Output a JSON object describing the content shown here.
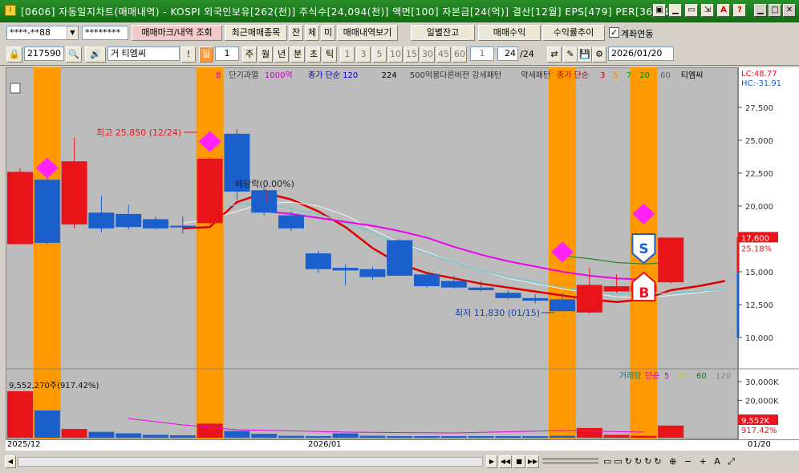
{
  "window": {
    "title": "[0606] 자동일지차트(매매내역) - KOSPI 외국인보유[262(천)] 주식수[24,094(천)] 액면[100] 자본금[24(억)] 결산[12월] EPS[479] PER[36.74]",
    "icon_label": "I",
    "title_icons": [
      "window-icon",
      "minimize-small-icon",
      "restore-small-icon",
      "link-icon",
      "print-icon",
      "help-icon"
    ],
    "title_icon_glyphs": [
      "▣",
      "▁",
      "▭",
      "⇲",
      "A",
      "?"
    ],
    "controls": [
      "▁",
      "□",
      "✕"
    ]
  },
  "toolbar1": {
    "account": "****-**88",
    "password": "********",
    "trade_mark_btn": "매매마크/내역 조회",
    "recent_trades_btn": "최근매매종목",
    "balance_btn": "잔",
    "fill_btn": "체",
    "unfilled_btn": "미",
    "trade_detail_btn": "매매내역보기",
    "daily_balance_btn": "일별잔고",
    "trade_profit_btn": "매매수익",
    "return_trend_btn": "수익률추이",
    "account_link_label": "계좌연동",
    "account_link_checked": true
  },
  "toolbar2": {
    "stock_code": "217590",
    "stock_name": "티엠씨",
    "stock_prefix": "거",
    "period_buttons": [
      "일",
      "주",
      "월",
      "년",
      "분",
      "초",
      "틱"
    ],
    "period_value": "1",
    "interval_buttons": [
      "1",
      "3",
      "5",
      "10",
      "15",
      "30",
      "45",
      "60"
    ],
    "interval_value": "1",
    "count": "24",
    "count_total": "/24",
    "date": "2026/01/20",
    "exclaim": "!"
  },
  "chart_legend": {
    "items": [
      {
        "text": "8",
        "color": "#cc00cc"
      },
      {
        "text": "단기과열",
        "color": "#333333"
      },
      {
        "text": "1000억",
        "color": "#cc00cc"
      },
      {
        "text": "종가 단순 120",
        "color": "#0000cc"
      },
      {
        "text": "224",
        "color": "#000000"
      },
      {
        "text": "500억봉다른버전 강세패턴",
        "color": "#333333"
      },
      {
        "text": "약세패턴",
        "color": "#333333"
      },
      {
        "text": "종가 단순",
        "color": "#cc0000"
      },
      {
        "text": "3",
        "color": "#cc0000"
      },
      {
        "text": "5",
        "color": "#ff8800"
      },
      {
        "text": "7",
        "color": "#00aa00"
      },
      {
        "text": "20",
        "color": "#008800"
      },
      {
        "text": "60",
        "color": "#666666"
      },
      {
        "text": "티엠씨",
        "color": "#000000"
      }
    ],
    "lc": "LC:48.77",
    "hc": "HC:-31.91"
  },
  "annotations": {
    "high": "최고 25,850 (12/24)",
    "low": "최저 11,830 (01/15)",
    "dividend": "배당락(0.00%)",
    "sell": "S",
    "buy": "B",
    "volume_max": "9,552,270주(917.42%)"
  },
  "price_axis": {
    "ticks": [
      "27,500",
      "25,000",
      "22,500",
      "20,000",
      "17,500",
      "15,000",
      "12,500",
      "10,000"
    ],
    "current_price": "17,600",
    "current_change": "25.18%"
  },
  "volume_legend": {
    "items": [
      {
        "text": "거래량",
        "color": "#008888"
      },
      {
        "text": "단순",
        "color": "#cc00cc"
      },
      {
        "text": "5",
        "color": "#cc00cc"
      },
      {
        "text": "20",
        "color": "#cccc00"
      },
      {
        "text": "60",
        "color": "#008800"
      },
      {
        "text": "120",
        "color": "#888888"
      }
    ],
    "ticks": [
      "30,000K",
      "20,000K",
      "10,000K"
    ],
    "current": "9,552K",
    "current_pct": "917.42%"
  },
  "x_axis": {
    "labels": [
      "2025/12",
      "2026/01"
    ],
    "right_label": "01/20"
  },
  "chart_data": {
    "type": "candlestick",
    "candles": [
      {
        "o": 17100,
        "h": 22900,
        "l": 17100,
        "c": 22600
      },
      {
        "o": 22000,
        "h": 22600,
        "l": 17100,
        "c": 17200
      },
      {
        "o": 18600,
        "h": 25200,
        "l": 18300,
        "c": 23400
      },
      {
        "o": 19500,
        "h": 20800,
        "l": 18000,
        "c": 18300
      },
      {
        "o": 19400,
        "h": 20100,
        "l": 18200,
        "c": 18400
      },
      {
        "o": 19000,
        "h": 19200,
        "l": 18200,
        "c": 18300
      },
      {
        "o": 18500,
        "h": 19200,
        "l": 17900,
        "c": 18400
      },
      {
        "o": 18700,
        "h": 23700,
        "l": 18600,
        "c": 23600
      },
      {
        "o": 25500,
        "h": 25850,
        "l": 20500,
        "c": 21100
      },
      {
        "o": 21200,
        "h": 21500,
        "l": 19300,
        "c": 19500
      },
      {
        "o": 19300,
        "h": 19600,
        "l": 18100,
        "c": 18300
      },
      {
        "o": 16400,
        "h": 16600,
        "l": 14900,
        "c": 15200
      },
      {
        "o": 15300,
        "h": 15600,
        "l": 14000,
        "c": 15100
      },
      {
        "o": 15200,
        "h": 15400,
        "l": 14400,
        "c": 14600
      },
      {
        "o": 17400,
        "h": 17500,
        "l": 14700,
        "c": 14700
      },
      {
        "o": 14800,
        "h": 15000,
        "l": 13800,
        "c": 13900
      },
      {
        "o": 14300,
        "h": 14700,
        "l": 13700,
        "c": 13800
      },
      {
        "o": 13800,
        "h": 14300,
        "l": 13500,
        "c": 13600
      },
      {
        "o": 13400,
        "h": 13600,
        "l": 12900,
        "c": 13000
      },
      {
        "o": 13000,
        "h": 13300,
        "l": 12600,
        "c": 12800
      },
      {
        "o": 12900,
        "h": 13400,
        "l": 12000,
        "c": 12000
      },
      {
        "o": 11900,
        "h": 15300,
        "l": 11830,
        "c": 14000
      },
      {
        "o": 13500,
        "h": 14800,
        "l": 13400,
        "c": 13900
      },
      {
        "o": 13500,
        "h": 14200,
        "l": 13200,
        "c": 14000
      },
      {
        "o": 14200,
        "h": 17600,
        "l": 14100,
        "c": 17600
      }
    ],
    "volumes": [
      9552,
      5600,
      1800,
      1200,
      900,
      600,
      500,
      2900,
      1400,
      800,
      400,
      300,
      900,
      400,
      300,
      250,
      200,
      250,
      200,
      200,
      400,
      2000,
      600,
      400,
      2500
    ],
    "highlighted_bars": [
      1,
      7,
      20,
      23
    ],
    "y_range": [
      10000,
      27500
    ]
  }
}
